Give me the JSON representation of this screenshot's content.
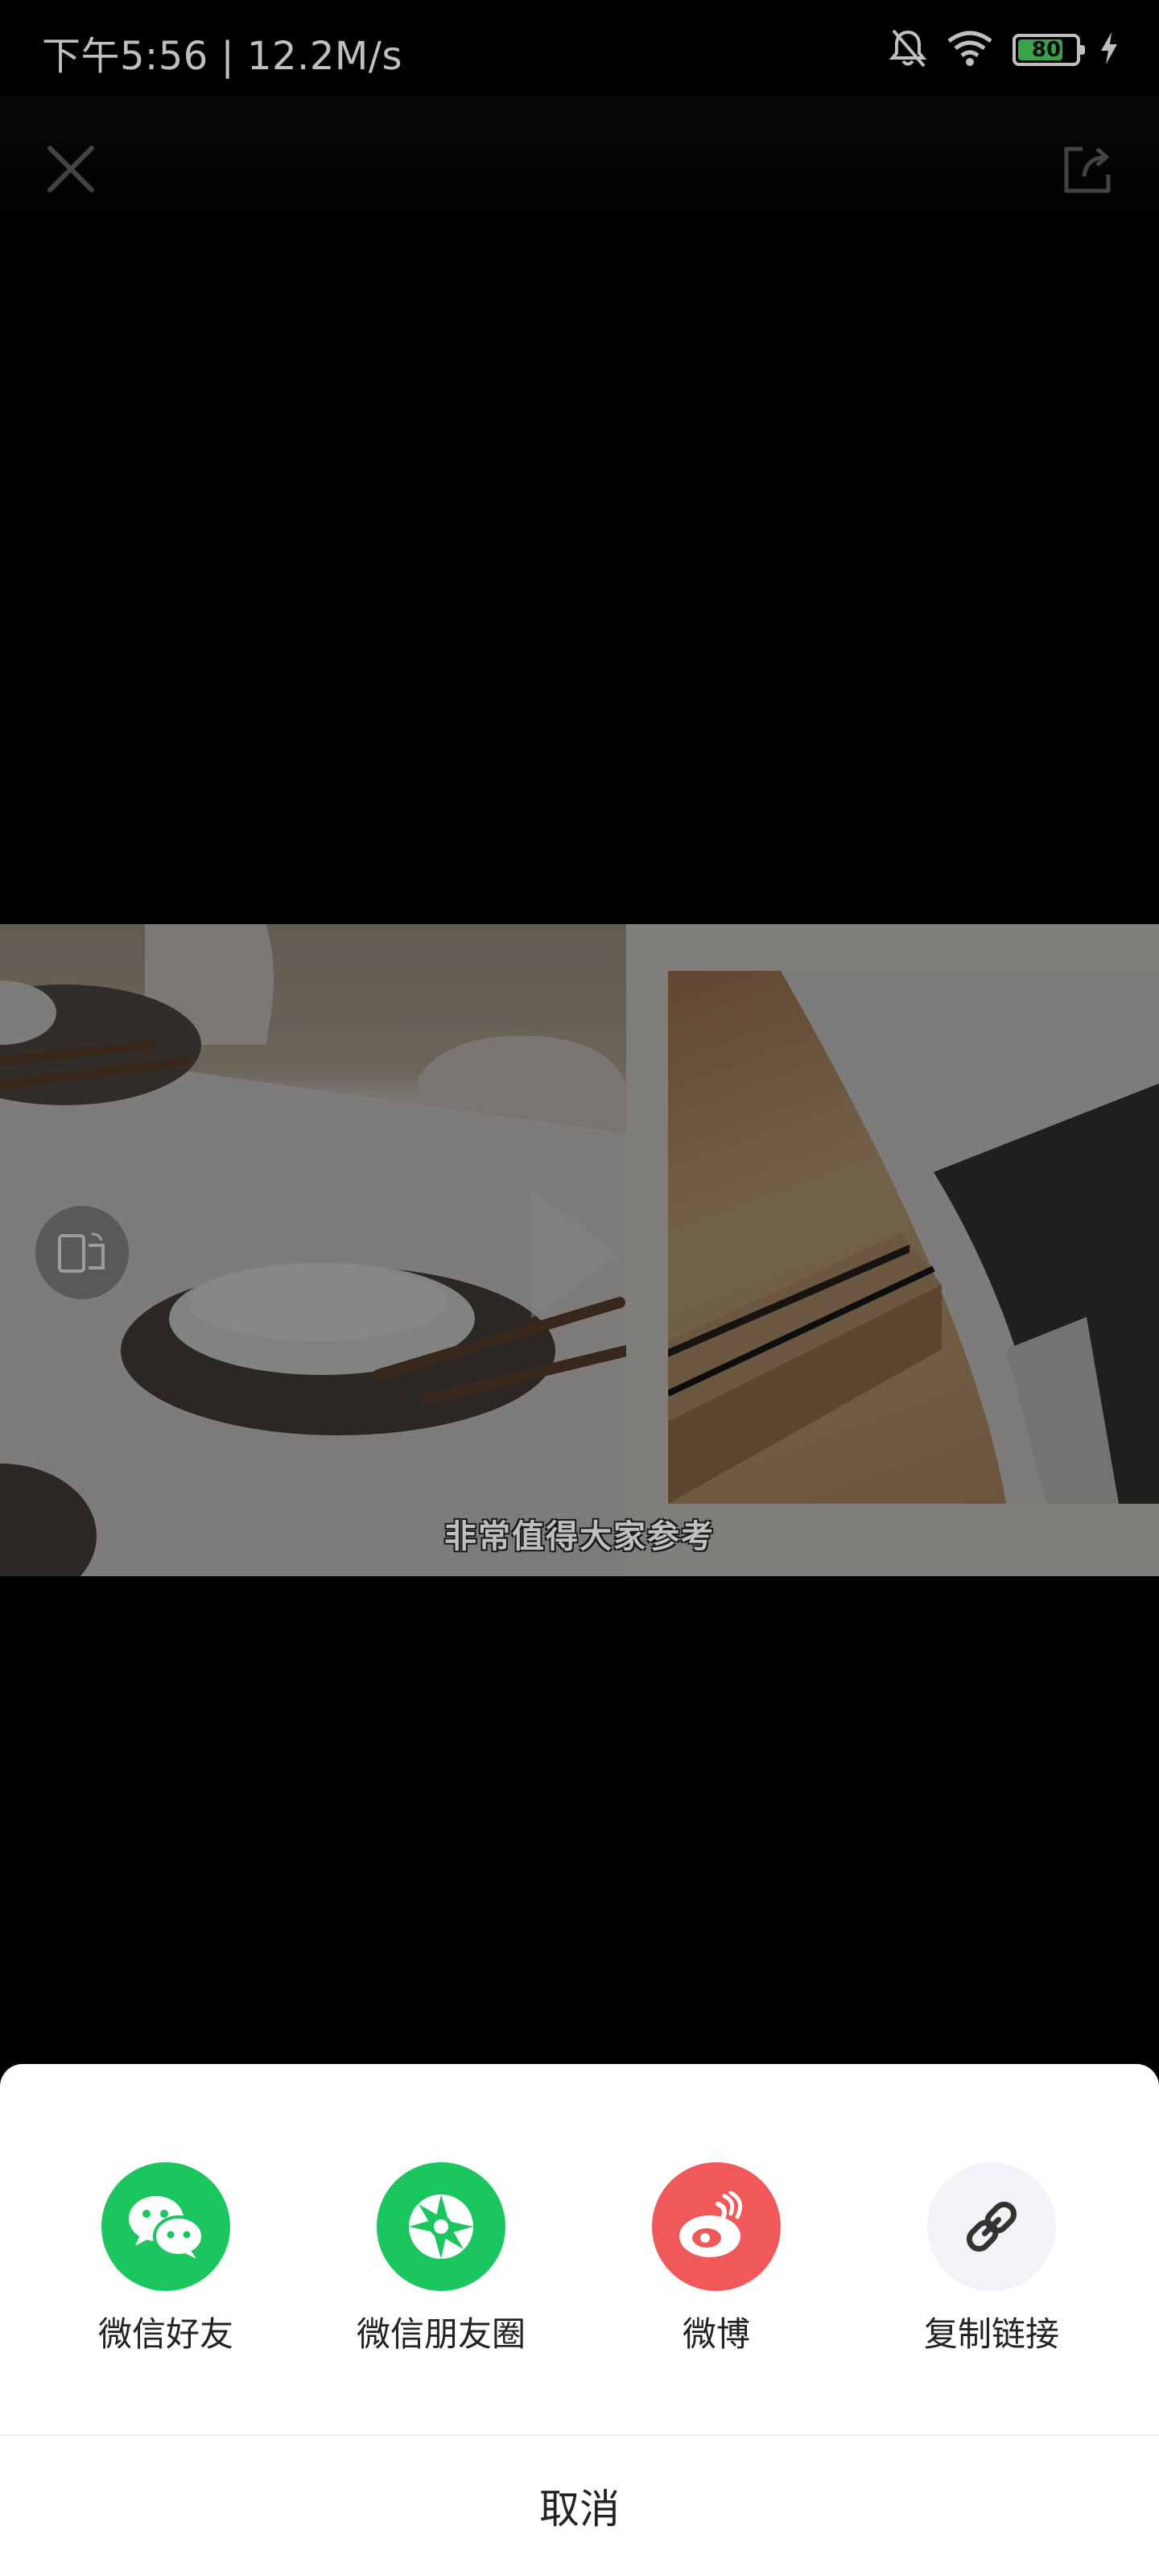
{
  "status_bar": {
    "time_speed": "下午5:56 | 12.2M/s",
    "battery_level": "80",
    "battery_percent": 0.8,
    "icons": [
      "bell-muted-icon",
      "wifi-icon",
      "battery-icon",
      "charging-bolt-icon"
    ]
  },
  "top_bar": {
    "icons": [
      "close-icon",
      "share-icon"
    ]
  },
  "video": {
    "subtitle": "非常值得大家参考",
    "icons": [
      "rotate-screen-icon"
    ]
  },
  "share_sheet": {
    "options": [
      {
        "label": "微信好友",
        "icon": "wechat-icon",
        "color": "#1bc65f"
      },
      {
        "label": "微信朋友圈",
        "icon": "moments-icon",
        "color": "#1bc65f"
      },
      {
        "label": "微博",
        "icon": "weibo-icon",
        "color": "#f0585a"
      },
      {
        "label": "复制链接",
        "icon": "link-icon",
        "color": "#f2f3f7"
      }
    ],
    "cancel_label": "取消"
  }
}
